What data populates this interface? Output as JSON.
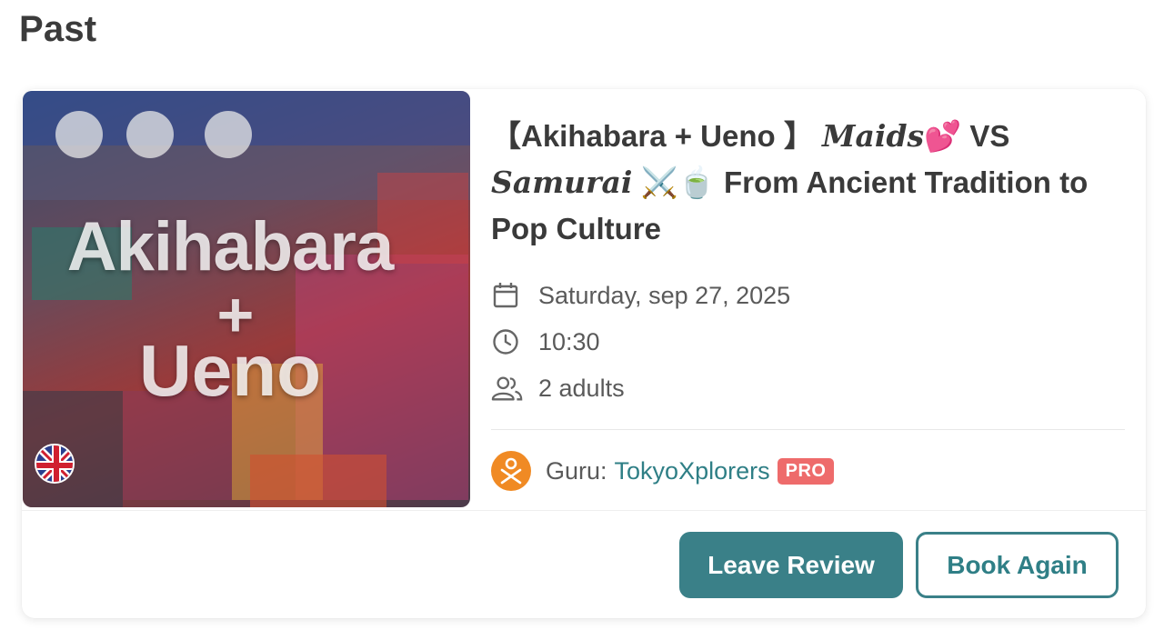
{
  "section": {
    "title": "Past"
  },
  "booking": {
    "title_part1": "【Akihabara + Ueno 】 ",
    "title_fancy1": "Maids",
    "title_emoji1": "💕",
    "title_part2": " VS",
    "title_fancy2": "Samurai",
    "title_emoji2": "⚔️🍵",
    "title_part3": " From Ancient Tradition to Pop Culture",
    "thumbnail": {
      "text_line1": "Akihabara",
      "text_line2": "+",
      "text_line3": "Ueno",
      "language_flag": "uk-flag-icon"
    },
    "date": "Saturday, sep 27, 2025",
    "time": "10:30",
    "guests": "2 adults",
    "guru_label": "Guru:",
    "guru_name": "TokyoXplorers",
    "guru_badge": "PRO"
  },
  "actions": {
    "leave_review": "Leave Review",
    "book_again": "Book Again"
  },
  "colors": {
    "accent": "#3a8088",
    "link": "#2f7f86",
    "pro_badge": "#ee6b6b",
    "guru_logo": "#f08a24"
  },
  "icons": {
    "date": "calendar-icon",
    "time": "clock-icon",
    "guests": "users-icon",
    "guru": "guru-logo-icon"
  }
}
